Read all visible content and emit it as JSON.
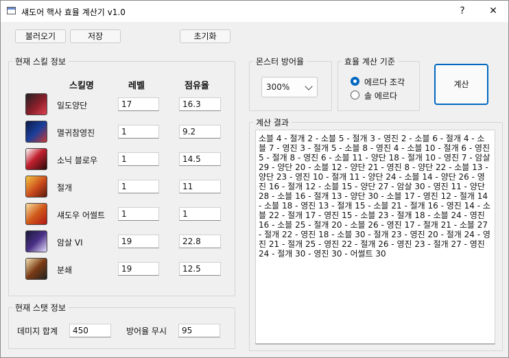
{
  "window": {
    "title": "섀도어 핵사 효율 계산기 v1.0",
    "help": "?",
    "close": "✕"
  },
  "toolbar": {
    "load": "불러오기",
    "save": "저장",
    "reset": "초기화"
  },
  "skill_group": {
    "title": "현재 스킬 정보",
    "headers": {
      "name": "스킬명",
      "level": "레벨",
      "share": "점유율"
    },
    "skills": [
      {
        "name": "일도양단",
        "level": "17",
        "share": "16.3",
        "icon": "ildo-yangdan-icon",
        "color": "#8b1f2a"
      },
      {
        "name": "멸귀참영진",
        "level": "1",
        "share": "9.2",
        "icon": "myeolgwi-chamyeongjin-icon",
        "color": "#1b3f9a"
      },
      {
        "name": "소닉 블로우",
        "level": "1",
        "share": "14.5",
        "icon": "sonic-blow-icon",
        "color": "#c2202e"
      },
      {
        "name": "절개",
        "level": "1",
        "share": "11",
        "icon": "jeolgae-icon",
        "color": "#c9481c"
      },
      {
        "name": "섀도우 어썰트",
        "level": "1",
        "share": "1",
        "icon": "shadow-assault-icon",
        "color": "#d05a1a"
      },
      {
        "name": "암살 VI",
        "level": "19",
        "share": "22.8",
        "icon": "amsal-icon",
        "color": "#4a2f86"
      },
      {
        "name": "분쇄",
        "level": "19",
        "share": "12.5",
        "icon": "bunswae-icon",
        "color": "#7a3a14"
      }
    ]
  },
  "stat_group": {
    "title": "현재 스탯 정보",
    "damage_label": "데미지 합계",
    "damage_value": "450",
    "ignore_label": "방어율 무시",
    "ignore_value": "95"
  },
  "monster_group": {
    "title": "몬스터 방어율",
    "selected": "300%"
  },
  "criteria_group": {
    "title": "효율 계산 기준",
    "options": [
      "에르다 조각",
      "솔 에르다"
    ],
    "selected_index": 0
  },
  "calc_button": "계산",
  "result_group": {
    "title": "계산 결과",
    "text": "소블 4 - 절개 2 - 소블 5 - 절개 3 - 영진 2 - 소블 6 - 절개 4 - 소블 7 - 영진 3 - 절개 5 - 소블 8 - 영진 4 - 소블 10 - 절개 6 - 영진 5 - 절개 8 - 영진 6 - 소블 11 - 양단 18 - 절개 10 - 영진 7 - 암살 29 - 양단 20 - 소블 12 - 양단 21 - 영진 8 - 양단 22 - 소블 13 - 양단 23 - 영진 10 - 절개 11 - 양단 24 - 소블 14 - 양단 26 - 영진 16 - 절개 12 - 소블 15 - 양단 27 - 암살 30 - 영진 11 - 양단 28 - 소블 16 - 절개 13 - 양단 30 - 소블 17 - 영진 12 - 절개 14 - 소블 18 - 영진 13 - 절개 15 - 소블 21 - 절개 16 - 영진 14 - 소블 22 - 절개 17 - 영진 15 - 소블 23 - 절개 18 - 소블 24 - 영진 16 - 소블 25 - 절개 20 - 소블 26 - 영진 17 - 절개 21 - 소블 27 - 절개 22 - 영진 18 - 소블 30 - 절개 23 - 영진 20 - 절개 24 - 영진 21 - 절개 25 - 영진 22 - 절개 26 - 영진 23 - 절개 27 - 영진 24 - 절개 30 - 영진 30 - 어썰트 30"
  }
}
